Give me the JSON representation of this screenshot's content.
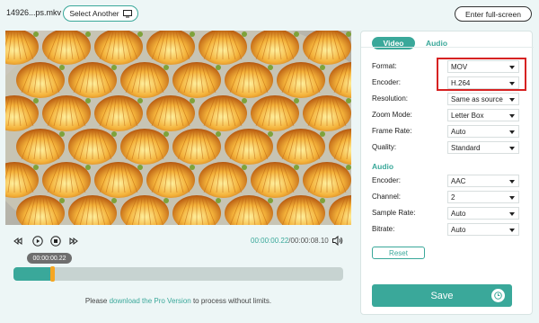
{
  "topbar": {
    "filename": "14926...ps.mkv",
    "select_another": "Select Another",
    "fullscreen": "Enter full-screen"
  },
  "player": {
    "image_icon": "photo-of-pastry",
    "current_time": "00:00:00.22",
    "total_time": "/00:00:08.10",
    "bubble_time": "00:00:00.22",
    "progress": 0.116
  },
  "footer": {
    "prefix": "Please ",
    "link": "download the Pro Version",
    "suffix": " to process without limits."
  },
  "tabs": [
    {
      "label": "Video",
      "active": true
    },
    {
      "label": "Audio",
      "active": false
    }
  ],
  "video_settings": [
    {
      "label": "Format:",
      "value": "MOV"
    },
    {
      "label": "Encoder:",
      "value": "H.264"
    },
    {
      "label": "Resolution:",
      "value": "Same as source"
    },
    {
      "label": "Zoom Mode:",
      "value": "Letter Box"
    },
    {
      "label": "Frame Rate:",
      "value": "Auto"
    },
    {
      "label": "Quality:",
      "value": "Standard"
    }
  ],
  "audio_section": "Audio",
  "audio_settings": [
    {
      "label": "Encoder:",
      "value": "AAC"
    },
    {
      "label": "Channel:",
      "value": "2"
    },
    {
      "label": "Sample Rate:",
      "value": "Auto"
    },
    {
      "label": "Bitrate:",
      "value": "Auto"
    }
  ],
  "reset": "Reset",
  "save": "Save",
  "colors": {
    "accent": "#3aa89a",
    "highlight": "#d62222",
    "handle": "#f5a623"
  }
}
